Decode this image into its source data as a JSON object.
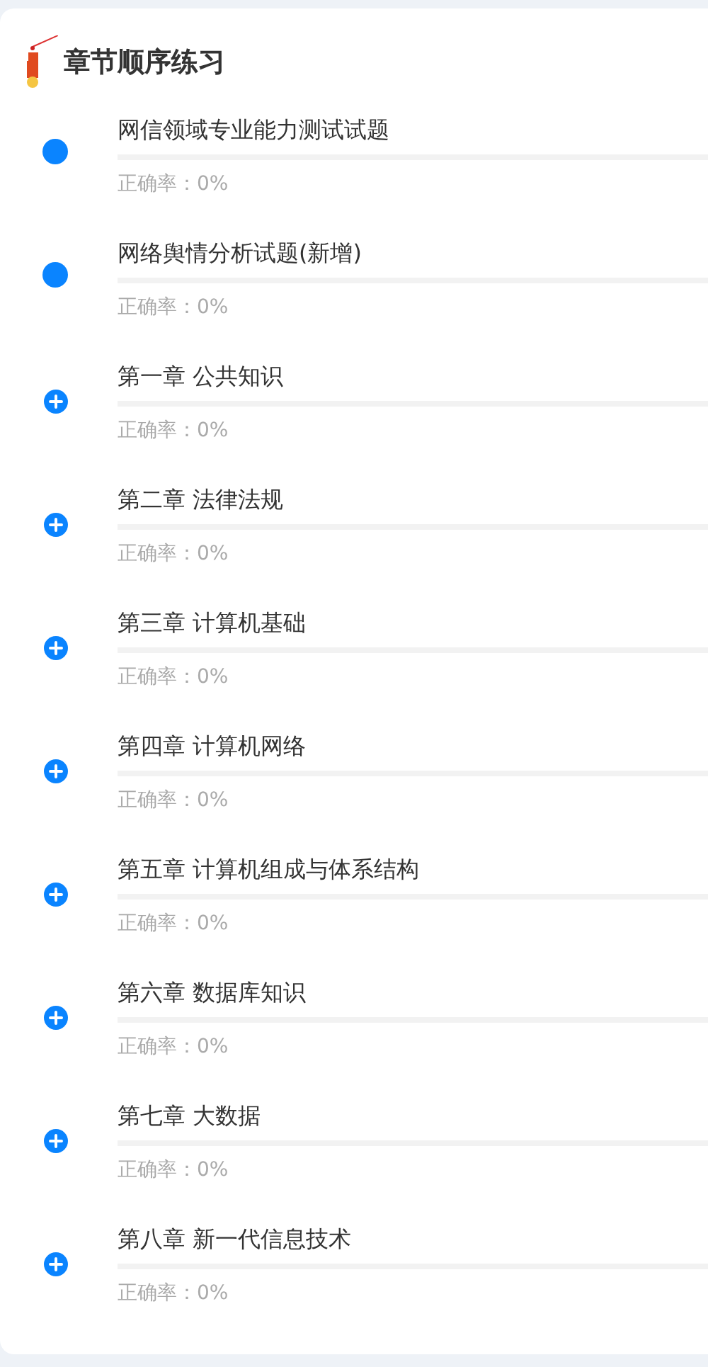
{
  "section": {
    "title": "章节顺序练习"
  },
  "chapters": [
    {
      "kind": "dot",
      "title": "网信领域专业能力测试试题",
      "level": 0,
      "accuracy": "正确率：0%"
    },
    {
      "kind": "dot",
      "title": "网络舆情分析试题(新增)",
      "level": 0,
      "accuracy": "正确率：0%"
    },
    {
      "kind": "expandable",
      "title": "第一章 公共知识",
      "level": 0,
      "accuracy": "正确率：0%"
    },
    {
      "kind": "expandable",
      "title": "第二章 法律法规",
      "level": 0,
      "accuracy": "正确率：0%"
    },
    {
      "kind": "expandable",
      "title": "第三章 计算机基础",
      "level": 0,
      "accuracy": "正确率：0%"
    },
    {
      "kind": "expandable",
      "title": "第四章 计算机网络",
      "level": 0,
      "accuracy": "正确率：0%"
    },
    {
      "kind": "expandable",
      "title": "第五章 计算机组成与体系结构",
      "level": 0,
      "accuracy": "正确率：0%"
    },
    {
      "kind": "expandable",
      "title": "第六章 数据库知识",
      "level": 0,
      "accuracy": "正确率：0%"
    },
    {
      "kind": "expandable",
      "title": "第七章 大数据",
      "level": 0,
      "accuracy": "正确率：0%"
    },
    {
      "kind": "expandable",
      "title": "第八章 新一代信息技术",
      "level": 0,
      "accuracy": "正确率：0%"
    }
  ]
}
